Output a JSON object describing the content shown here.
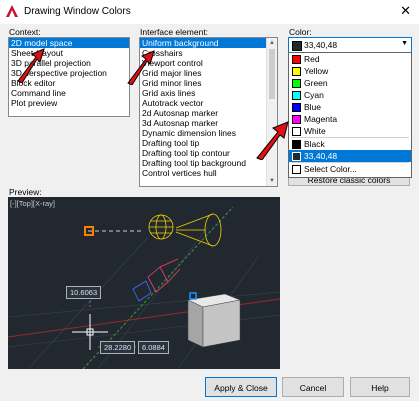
{
  "window": {
    "title": "Drawing Window Colors"
  },
  "context": {
    "label": "Context:",
    "items": [
      "2D model space",
      "Sheet / layout",
      "3D parallel projection",
      "3D perspective projection",
      "Block editor",
      "Command line",
      "Plot preview"
    ],
    "selected_index": 0
  },
  "interface_element": {
    "label": "Interface element:",
    "items": [
      "Uniform background",
      "Crosshairs",
      "Viewport control",
      "Grid major lines",
      "Grid minor lines",
      "Grid axis lines",
      "Autotrack vector",
      "2d Autosnap marker",
      "3d Autosnap marker",
      "Dynamic dimension lines",
      "Drafting tool tip",
      "Drafting tool tip contour",
      "Drafting tool tip background",
      "Control vertices hull"
    ],
    "selected_index": 0
  },
  "color": {
    "label": "Color:",
    "current_value": "33,40,48",
    "current_swatch": "#212830",
    "options": [
      {
        "label": "Red",
        "swatch": "#ff0000"
      },
      {
        "label": "Yellow",
        "swatch": "#ffff00"
      },
      {
        "label": "Green",
        "swatch": "#00ff00"
      },
      {
        "label": "Cyan",
        "swatch": "#00ffff"
      },
      {
        "label": "Blue",
        "swatch": "#0000ff"
      },
      {
        "label": "Magenta",
        "swatch": "#ff00ff"
      },
      {
        "label": "White",
        "swatch": "#ffffff"
      },
      {
        "label": "Black",
        "swatch": "#000000"
      },
      {
        "label": "33,40,48",
        "swatch": "#212830"
      },
      {
        "label": "Select Color...",
        "swatch": "#ffffff"
      }
    ],
    "selected_option_index": 8,
    "restore_button": "Restore classic colors"
  },
  "preview": {
    "label": "Preview:",
    "viewport_tag": "[-][Top][X-ray]",
    "dim_values": [
      "10.6063",
      "28.2280",
      "6.0884"
    ]
  },
  "buttons": {
    "apply_close": "Apply & Close",
    "cancel": "Cancel",
    "help": "Help"
  },
  "colors": {
    "accent": "#0078d7",
    "annotation_arrow": "#e01010",
    "preview_bg": "#212830"
  }
}
